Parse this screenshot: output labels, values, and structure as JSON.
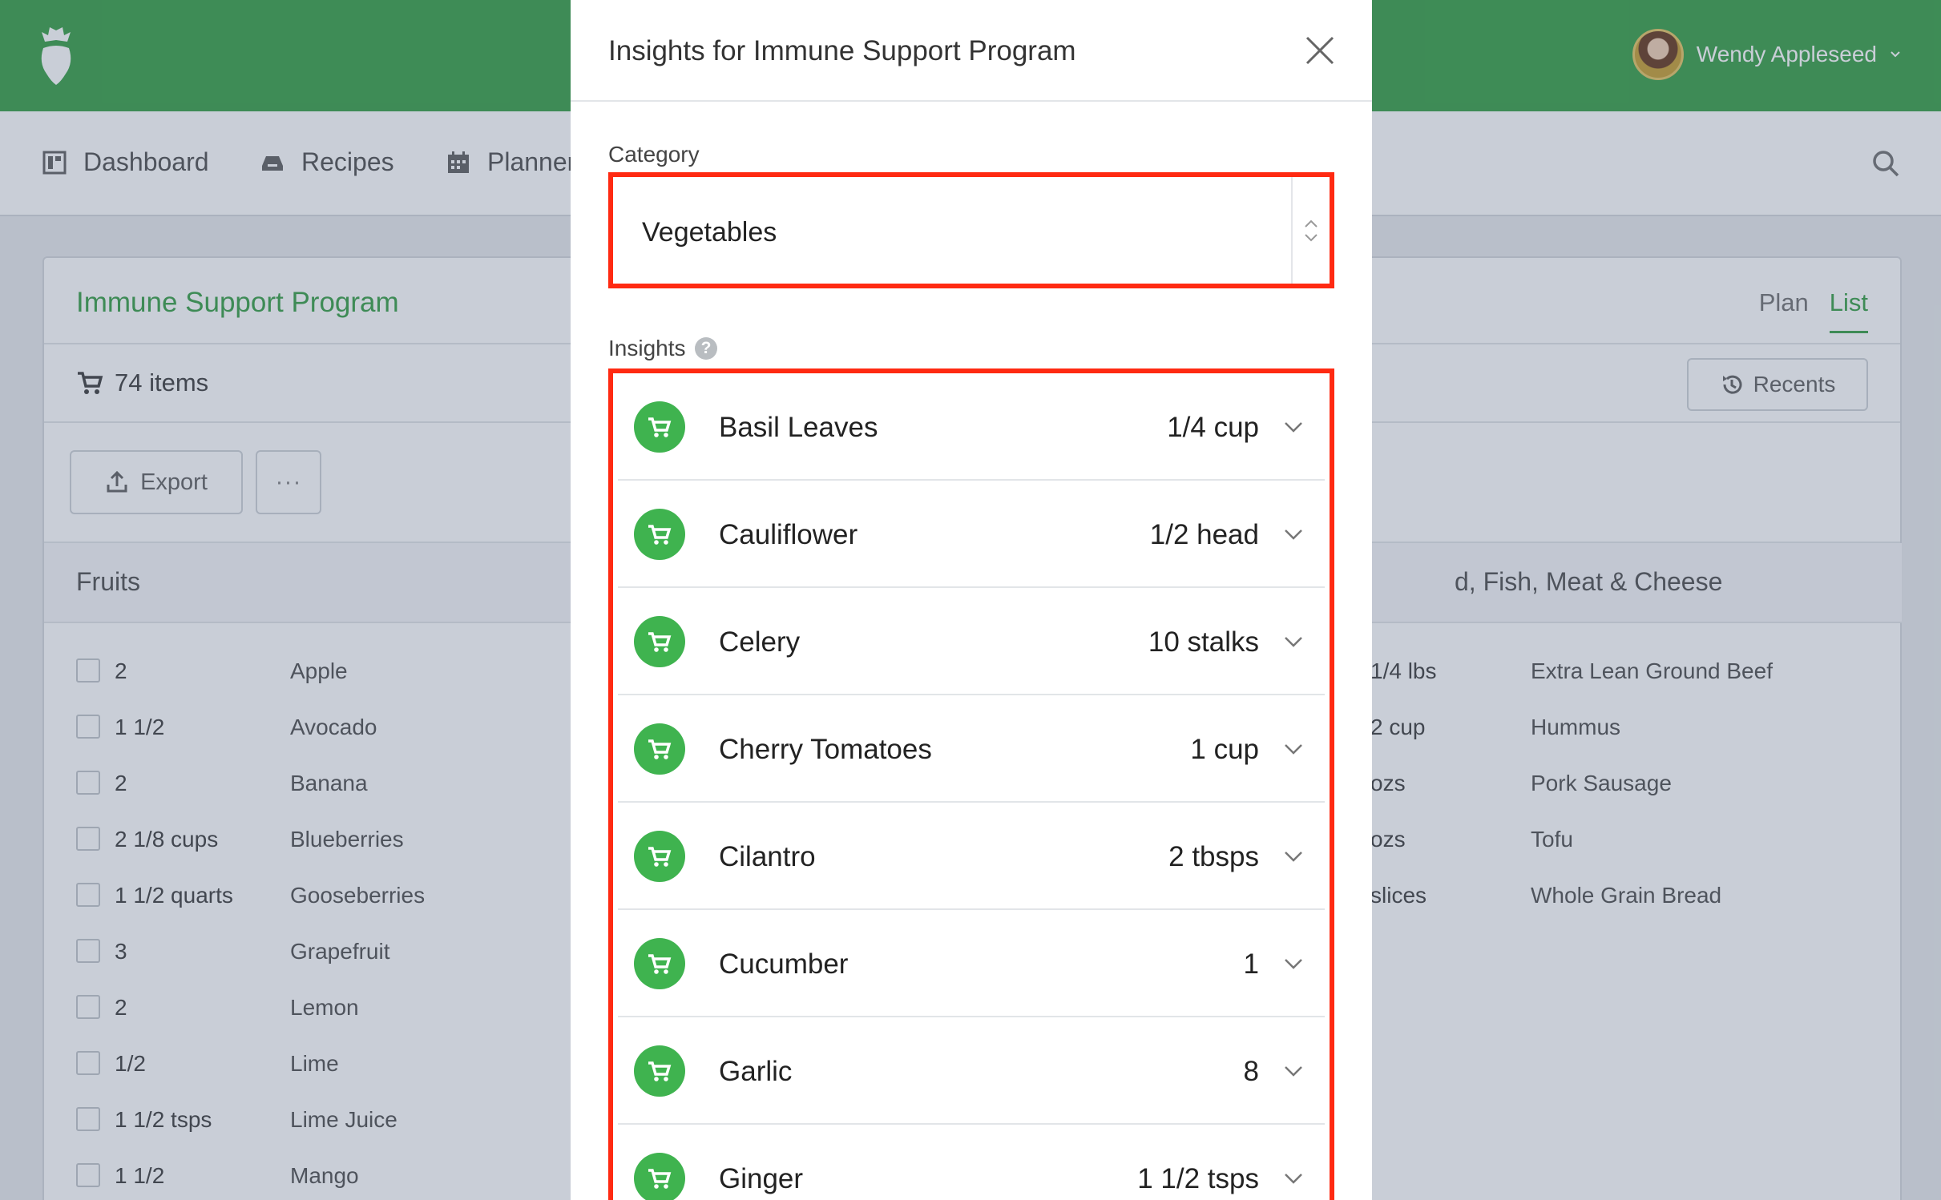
{
  "user": {
    "name": "Wendy Appleseed"
  },
  "nav": {
    "items": [
      {
        "label": "Dashboard",
        "icon": "dashboard-icon"
      },
      {
        "label": "Recipes",
        "icon": "recipes-icon"
      },
      {
        "label": "Planner",
        "icon": "calendar-icon"
      }
    ]
  },
  "program": {
    "title": "Immune Support Program",
    "tabs": [
      "Plan",
      "List"
    ],
    "active_tab": "List",
    "item_count": "74 items",
    "recents_label": "Recents",
    "export_label": "Export",
    "more_label": "···"
  },
  "fruits": {
    "title": "Fruits",
    "items": [
      {
        "qty": "2",
        "name": "Apple"
      },
      {
        "qty": "1 1/2",
        "name": "Avocado"
      },
      {
        "qty": "2",
        "name": "Banana"
      },
      {
        "qty": "2 1/8 cups",
        "name": "Blueberries"
      },
      {
        "qty": "1 1/2 quarts",
        "name": "Gooseberries"
      },
      {
        "qty": "3",
        "name": "Grapefruit"
      },
      {
        "qty": "2",
        "name": "Lemon"
      },
      {
        "qty": "1/2",
        "name": "Lime"
      },
      {
        "qty": "1 1/2 tsps",
        "name": "Lime Juice"
      },
      {
        "qty": "1 1/2",
        "name": "Mango"
      }
    ]
  },
  "proteins": {
    "title": "d, Fish, Meat & Cheese",
    "items": [
      {
        "qty": "1/4 lbs",
        "name": "Extra Lean Ground Beef"
      },
      {
        "qty": "2 cup",
        "name": "Hummus"
      },
      {
        "qty": "ozs",
        "name": "Pork Sausage"
      },
      {
        "qty": "ozs",
        "name": "Tofu"
      },
      {
        "qty": "slices",
        "name": "Whole Grain Bread"
      }
    ]
  },
  "modal": {
    "title": "Insights for Immune Support Program",
    "category_label": "Category",
    "category_value": "Vegetables",
    "insights_label": "Insights",
    "help_glyph": "?",
    "highlight_color": "#ff2a12",
    "insights": [
      {
        "name": "Basil Leaves",
        "qty": "1/4 cup"
      },
      {
        "name": "Cauliflower",
        "qty": "1/2 head"
      },
      {
        "name": "Celery",
        "qty": "10 stalks"
      },
      {
        "name": "Cherry Tomatoes",
        "qty": "1 cup"
      },
      {
        "name": "Cilantro",
        "qty": "2 tbsps"
      },
      {
        "name": "Cucumber",
        "qty": "1"
      },
      {
        "name": "Garlic",
        "qty": "8"
      },
      {
        "name": "Ginger",
        "qty": "1 1/2 tsps"
      }
    ]
  },
  "colors": {
    "brand": "#3fa34d",
    "cart_icon_bg": "#3fb34f"
  }
}
